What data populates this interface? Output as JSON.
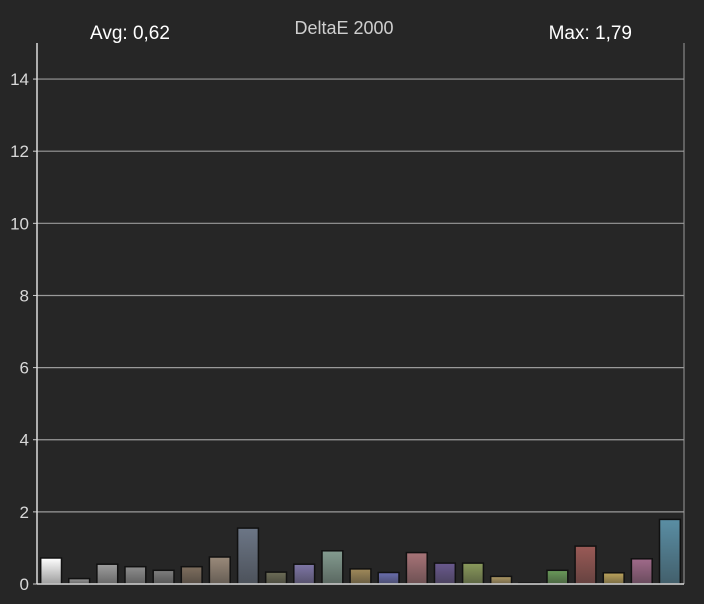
{
  "chart_data": {
    "type": "bar",
    "title": "DeltaE 2000",
    "avg_label": "Avg: 0,62",
    "max_label": "Max: 1,79",
    "ylim": [
      0,
      15
    ],
    "yticks": [
      "0",
      "2",
      "4",
      "6",
      "8",
      "10",
      "12",
      "14"
    ],
    "grid": true,
    "values": [
      0.72,
      0.15,
      0.55,
      0.48,
      0.38,
      0.48,
      0.75,
      1.55,
      0.33,
      0.55,
      0.92,
      0.42,
      0.32,
      0.87,
      0.58,
      0.58,
      0.21,
      0.02,
      0.38,
      1.05,
      0.31,
      0.7,
      1.79
    ],
    "colors": [
      "#ffffff",
      "#9a9a9a",
      "#9e9e9e",
      "#8e8e8e",
      "#7e7e7e",
      "#7e6e5e",
      "#9a8a7a",
      "#6c7686",
      "#6c6c56",
      "#7e76a6",
      "#849c90",
      "#a08a5a",
      "#6a6eae",
      "#a87478",
      "#6a5a8e",
      "#8a9a5c",
      "#b09a66",
      "#8a8a8a",
      "#6a9a5a",
      "#9a5a56",
      "#bca45c",
      "#a06a8a",
      "#5a8ea4"
    ]
  }
}
